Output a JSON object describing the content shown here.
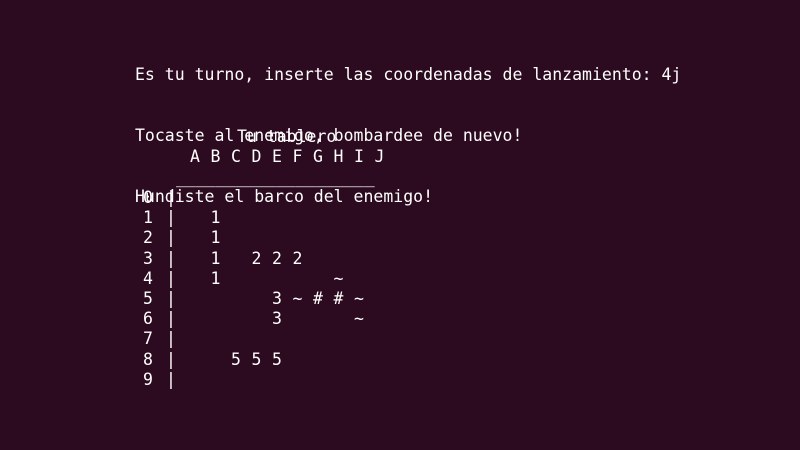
{
  "messages": [
    "Es tu turno, inserte las coordenadas de lanzamiento: 4j",
    "Tocaste al enemigo, bombardee de nuevo!",
    "Hundiste el barco del enemigo!"
  ],
  "board": {
    "title": "Tu tablero",
    "columns": [
      "A",
      "B",
      "C",
      "D",
      "E",
      "F",
      "G",
      "H",
      "I",
      "J"
    ],
    "rule": "____________________",
    "separator": "|",
    "rows": [
      {
        "label": "0",
        "cells": [
          "",
          "",
          "",
          "",
          "",
          "",
          "",
          "",
          "",
          ""
        ]
      },
      {
        "label": "1",
        "cells": [
          "",
          "1",
          "",
          "",
          "",
          "",
          "",
          "",
          "",
          ""
        ]
      },
      {
        "label": "2",
        "cells": [
          "",
          "1",
          "",
          "",
          "",
          "",
          "",
          "",
          "",
          ""
        ]
      },
      {
        "label": "3",
        "cells": [
          "",
          "1",
          "",
          "2",
          "2",
          "2",
          "",
          "",
          "",
          ""
        ]
      },
      {
        "label": "4",
        "cells": [
          "",
          "1",
          "",
          "",
          "",
          "",
          "",
          "~",
          "",
          ""
        ]
      },
      {
        "label": "5",
        "cells": [
          "",
          "",
          "",
          "",
          "3",
          "~",
          "#",
          "#",
          "~",
          ""
        ]
      },
      {
        "label": "6",
        "cells": [
          "",
          "",
          "",
          "",
          "3",
          "",
          "",
          "",
          "~",
          ""
        ]
      },
      {
        "label": "7",
        "cells": [
          "",
          "",
          "",
          "",
          "",
          "",
          "",
          "",
          "",
          ""
        ]
      },
      {
        "label": "8",
        "cells": [
          "",
          "",
          "5",
          "5",
          "5",
          "",
          "",
          "",
          "",
          ""
        ]
      },
      {
        "label": "9",
        "cells": [
          "",
          "",
          "",
          "",
          "",
          "",
          "",
          "",
          "",
          ""
        ]
      }
    ]
  }
}
